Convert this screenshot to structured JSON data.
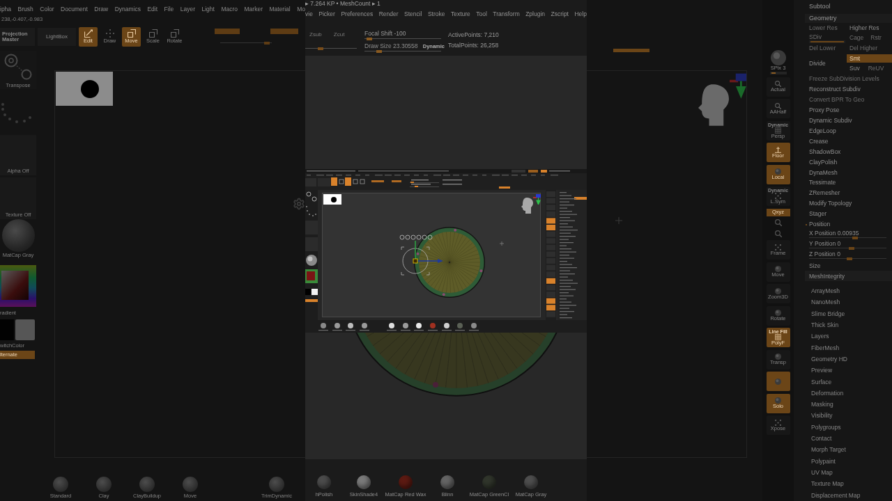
{
  "status_line": "▸ 7.264 KP • MeshCount ▸ 1",
  "menu_left": [
    "ipha",
    "Brush",
    "Color",
    "Document",
    "Draw",
    "Dynamics",
    "Edit",
    "File",
    "Layer",
    "Light",
    "Macro",
    "Marker",
    "Material",
    "Mo"
  ],
  "coordinates": "238,-0.407,-0.983",
  "toolbar": [
    {
      "label": "Projection Master",
      "kind": "panel",
      "selected": false
    },
    {
      "label": "LightBox",
      "kind": "panel",
      "selected": false
    },
    {
      "label": "Edit",
      "kind": "tool",
      "selected": true
    },
    {
      "label": "Draw",
      "kind": "tool",
      "selected": false
    },
    {
      "label": "Move",
      "kind": "tool",
      "selected": true
    },
    {
      "label": "Scale",
      "kind": "tool",
      "selected": false
    },
    {
      "label": "Rotate",
      "kind": "tool",
      "selected": false
    }
  ],
  "color_toggles": [
    {
      "on": true
    },
    {
      "on": true
    }
  ],
  "intensity_slider": {
    "level": 0.95
  },
  "menu_center": [
    "vie",
    "Picker",
    "Preferences",
    "Render",
    "Stencil",
    "Stroke",
    "Texture",
    "Tool",
    "Transform",
    "Zplugin",
    "Zscript",
    "Help"
  ],
  "draw_modes": [
    "Zsub",
    "Zcut"
  ],
  "z_slider": {
    "level": 0.27
  },
  "brush_sliders": [
    {
      "label": "Focal Shift -100",
      "level": 0.03
    },
    {
      "label": "Draw Size 23.30558",
      "level": 0.17
    }
  ],
  "dynamic_label": "Dynamic",
  "stats": [
    "ActivePoints: 7,210",
    "TotalPoints: 26,258"
  ],
  "toggle_bar": {
    "on": true
  },
  "left_shelf": {
    "transpose": "Transpose",
    "alpha": "Alpha Off",
    "texture": "Texture Off",
    "material": "MatCap Gray",
    "gradient": "radient",
    "switch_color": "witchColor",
    "alternate": {
      "label": "lternate",
      "on": true
    }
  },
  "brushes": [
    "Standard",
    "Clay",
    "ClayBuildup",
    "Move",
    "TrimDynamic"
  ],
  "materials": [
    {
      "label": "hPolish",
      "color": "#4b4b4b"
    },
    {
      "label": "SkinShade4",
      "color": "#7a7a7a"
    },
    {
      "label": "MatCap Red Wax",
      "color": "#5c1a12"
    },
    {
      "label": "Blinn",
      "color": "#646464"
    },
    {
      "label": "MatCap GreenCl",
      "color": "#30352b"
    },
    {
      "label": "MatCap Gray",
      "color": "#4e4e4e"
    }
  ],
  "right_shelf": [
    {
      "label": "SPix 3",
      "kind": "slider",
      "level": 0.35
    },
    {
      "label": "Actual",
      "kind": "button",
      "on": false
    },
    {
      "label": "AAHalf",
      "kind": "button",
      "on": false
    },
    {
      "label": "Persp",
      "caption": "Dynamic",
      "kind": "button",
      "on": false
    },
    {
      "label": "Floor",
      "kind": "button",
      "on": true
    },
    {
      "label": "Local",
      "kind": "button",
      "on": true
    },
    {
      "label": "L.Sym",
      "caption": "Dynamic",
      "kind": "button",
      "on": false
    },
    {
      "label": "Qxyz",
      "kind": "small",
      "on": true
    },
    {
      "kind": "icon",
      "on": false
    },
    {
      "kind": "icon",
      "on": false
    },
    {
      "label": "Frame",
      "kind": "button",
      "on": false
    },
    {
      "label": "Move",
      "kind": "button",
      "on": false
    },
    {
      "label": "Zoom3D",
      "kind": "button",
      "on": false
    },
    {
      "label": "Rotate",
      "kind": "button",
      "on": false
    },
    {
      "label": "PolyF",
      "caption": "Line Fill",
      "kind": "button",
      "on": true
    },
    {
      "label": "Transp",
      "kind": "button",
      "on": false
    },
    {
      "kind": "button",
      "on": true
    },
    {
      "label": "Solo",
      "kind": "button",
      "on": true
    },
    {
      "label": "Xpose",
      "kind": "button",
      "on": false
    }
  ],
  "palette": {
    "subtool": "Subtool",
    "geometry": "Geometry",
    "geometry_rows": [
      {
        "kind": "pair",
        "cells": [
          {
            "label": "Lower Res",
            "disabled": true,
            "on": false
          },
          {
            "label": "Higher Res",
            "disabled": false,
            "on": false
          }
        ]
      },
      {
        "kind": "slider",
        "cells": [
          {
            "label": "SDiv",
            "disabled": true,
            "on": false,
            "level": 1
          },
          {
            "label": "Cage",
            "disabled": true,
            "on": false
          },
          {
            "label": "Rstr",
            "disabled": true,
            "on": false
          }
        ]
      },
      {
        "kind": "pair",
        "cells": [
          {
            "label": "Del Lower",
            "disabled": true,
            "on": false
          },
          {
            "label": "Del Higher",
            "disabled": true,
            "on": false
          }
        ]
      },
      {
        "kind": "split",
        "cells": [
          {
            "label": "Divide",
            "disabled": false,
            "on": false
          },
          {
            "label": "Smt",
            "disabled": false,
            "on": true
          },
          {
            "label": "Suv",
            "disabled": false,
            "on": false
          },
          {
            "label": "ReUV",
            "disabled": true,
            "on": false
          }
        ]
      }
    ],
    "items": [
      {
        "label": "Freeze SubDivision Levels",
        "kind": "item",
        "disabled": true
      },
      {
        "label": "Reconstruct Subdiv",
        "kind": "item",
        "disabled": false
      },
      {
        "label": "Convert BPR To Geo",
        "kind": "item",
        "disabled": true
      },
      {
        "label": "Proxy Pose",
        "kind": "item",
        "disabled": false
      },
      {
        "label": "Dynamic Subdiv",
        "kind": "item",
        "disabled": false
      },
      {
        "label": "EdgeLoop",
        "kind": "item",
        "disabled": false
      },
      {
        "label": "Crease",
        "kind": "item",
        "disabled": false
      },
      {
        "label": "ShadowBox",
        "kind": "item",
        "disabled": false
      },
      {
        "label": "ClayPolish",
        "kind": "item",
        "disabled": false
      },
      {
        "label": "DynaMesh",
        "kind": "item",
        "disabled": false
      },
      {
        "label": "Tessimate",
        "kind": "item",
        "disabled": false
      },
      {
        "label": "ZRemesher",
        "kind": "item",
        "disabled": false
      },
      {
        "label": "Modify Topology",
        "kind": "item",
        "disabled": false
      },
      {
        "label": "Stager",
        "kind": "item",
        "disabled": false
      },
      {
        "label": "Position",
        "kind": "section",
        "disabled": false,
        "expanded": true
      },
      {
        "label": "X Position 0.00935",
        "kind": "slider",
        "disabled": false,
        "level": 0.6
      },
      {
        "label": "Y Position 0",
        "kind": "slider",
        "disabled": false,
        "level": 0.55
      },
      {
        "label": "Z Position 0",
        "kind": "slider",
        "disabled": false,
        "level": 0.52
      },
      {
        "label": "Size",
        "kind": "item",
        "disabled": false
      },
      {
        "label": "MeshIntegrity",
        "kind": "header",
        "disabled": false
      }
    ],
    "subpalettes": [
      "ArrayMesh",
      "NanoMesh",
      "Slime Bridge",
      "Thick Skin",
      "Layers",
      "FiberMesh",
      "Geometry HD",
      "Preview",
      "Surface",
      "Deformation",
      "Masking",
      "Visibility",
      "Polygroups",
      "Contact",
      "Morph Target",
      "Polypaint",
      "UV Map",
      "Texture Map",
      "Displacement Map"
    ]
  }
}
